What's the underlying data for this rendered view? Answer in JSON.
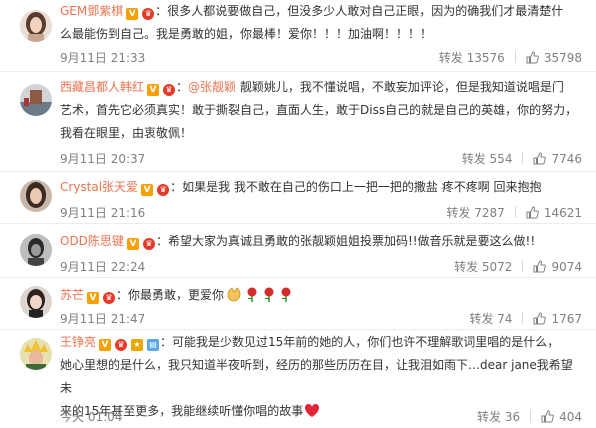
{
  "icons": {
    "like": "thumbs-up-outline-icon",
    "verified": "orange-v-verified-badge",
    "vip": "red-vip-crown-badge"
  },
  "colors": {
    "username": "#eb7350",
    "meta": "#808080",
    "divider": "#ececec"
  },
  "comments": [
    {
      "username": "GEM鄧紫棋",
      "text_lines": [
        "：很多人都说要做自己，但没多少人敢对自己正眼，因为的确我们才最清楚什",
        "么最能伤到自己。我是勇敢的姐，你最棒！爱你！！！加油啊！！！！"
      ],
      "time": "9月11日 21:33",
      "repost_label": "转发",
      "repost_count": "13576",
      "likes": "35798"
    },
    {
      "username": "西藏昌都人韩红",
      "mention": "@张靓颖",
      "text_lines": [
        " 靓颖姚儿，我不懂说唱，不敢妄加评论，但是我知道说唱是门",
        "艺术，首先它必须真实！敢于撕裂自己，直面人生，敢于Diss自己的就是自己的英雄，你的努力，",
        "我看在眼里，由衷敬佩！"
      ],
      "time": "9月11日 20:37",
      "repost_label": "转发",
      "repost_count": "554",
      "likes": "7746"
    },
    {
      "username": "Crystal张天爱",
      "text_lines": [
        "：如果是我 我不敢在自己的伤口上一把一把的撒盐 疼不疼啊 回来抱抱"
      ],
      "time": "9月11日 21:16",
      "repost_label": "转发",
      "repost_count": "7287",
      "likes": "14621"
    },
    {
      "username": "ODD陈思键",
      "text_lines": [
        "：希望大家为真诚且勇敢的张靓颖姐姐投票加码!!做音乐就是要这么做!!"
      ],
      "time": "9月11日 22:24",
      "repost_label": "转发",
      "repost_count": "5072",
      "likes": "9074"
    },
    {
      "username": "苏芒",
      "text_lines": [
        "：你最勇敢，更爱你"
      ],
      "emojis": [
        "clap-emoji",
        "rose-emoji",
        "rose-emoji",
        "rose-emoji"
      ],
      "time": "9月11日 21:47",
      "repost_label": "转发",
      "repost_count": "74",
      "likes": "1767"
    },
    {
      "username": "王铮亮",
      "text_lines": [
        "：可能我是少数见过15年前的她的人，你们也许不理解歌词里唱的是什么，",
        "她心里想的是什么，我只知道半夜听到，经历的那些历历在目，让我泪如雨下…dear jane我希望未",
        "来的15年甚至更多，我能继续听懂你唱的故事"
      ],
      "emojis": [
        "heart-emoji"
      ],
      "time": "今天 01:04",
      "repost_label": "转发",
      "repost_count": "36",
      "likes": "404"
    }
  ]
}
